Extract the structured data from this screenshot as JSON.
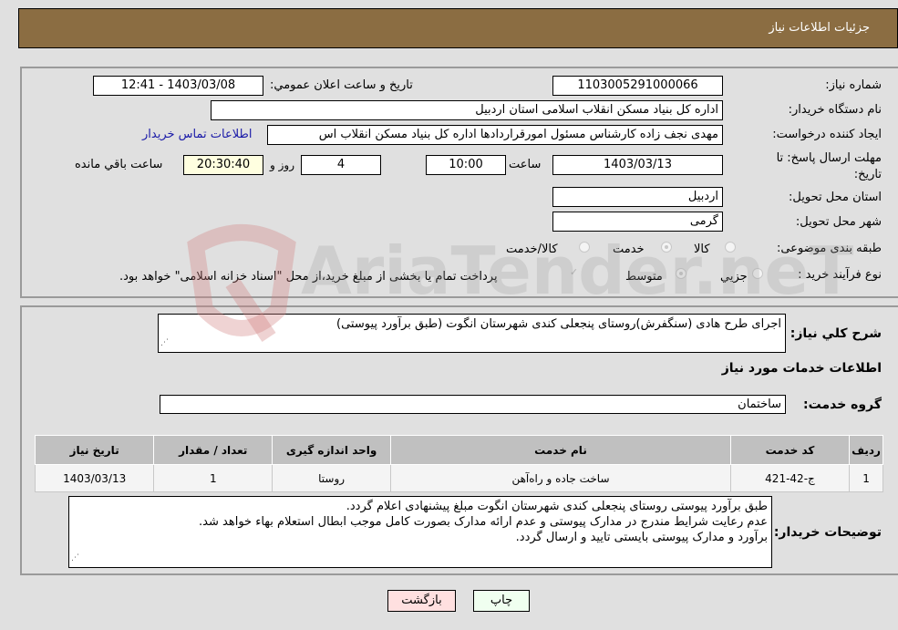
{
  "header": {
    "title": "جزئیات اطلاعات نیاز"
  },
  "fields": {
    "need_number_label": "شماره نیاز:",
    "need_number": "1103005291000066",
    "announce_label": "تاریخ و ساعت اعلان عمومي:",
    "announce_value": "1403/03/08 - 12:41",
    "buyer_org_label": "نام دستگاه خریدار:",
    "buyer_org": "اداره کل بنیاد مسکن انقلاب اسلامی استان اردبیل",
    "creator_label": "ایجاد کننده درخواست:",
    "creator": "مهدی نجف زاده کارشناس مسئول امورقراردادها اداره کل بنیاد مسکن انقلاب اس",
    "contact_link": "اطلاعات تماس خریدار",
    "deadline_label_1": "مهلت ارسال پاسخ: تا",
    "deadline_label_2": "تاریخ:",
    "deadline_date": "1403/03/13",
    "time_label": "ساعت",
    "deadline_time": "10:00",
    "days_value": "4",
    "days_label": "روز و",
    "remaining_time": "20:30:40",
    "remaining_label": "ساعت باقي مانده",
    "province_label": "استان محل تحویل:",
    "province": "اردبیل",
    "city_label": "شهر محل تحویل:",
    "city": "گرمی",
    "category_label": "طبقه بندی موضوعی:",
    "category_options": [
      "کالا",
      "خدمت",
      "کالا/خدمت"
    ],
    "category_selected": "خدمت",
    "process_label": "نوع فرآیند خرید :",
    "process_options": [
      "جزيي",
      "متوسط"
    ],
    "process_selected": "متوسط",
    "payment_note": "پرداخت تمام یا بخشی از مبلغ خرید،از محل \"اسناد خزانه اسلامی\" خواهد بود."
  },
  "description": {
    "label": "شرح كلي نياز:",
    "value": "اجرای طرح هادی (سنگفرش)روستای پنجعلی کندی شهرستان انگوت  (طبق برآورد  پیوستی)"
  },
  "services": {
    "section_title": "اطلاعات خدمات مورد نياز",
    "group_label": "گروه خدمت:",
    "group_value": "ساختمان",
    "columns": [
      "رديف",
      "كد خدمت",
      "نام خدمت",
      "واحد اندازه گيری",
      "تعداد / مقدار",
      "تاريخ نياز"
    ],
    "rows": [
      [
        "1",
        "ج-42-421",
        "ساخت جاده و راه‌آهن",
        "روستا",
        "1",
        "1403/03/13"
      ]
    ]
  },
  "buyer_notes": {
    "label": "توضيحات خريدار:",
    "lines": [
      "طبق برآورد پیوستی روستای پنجعلی کندی شهرستان انگوت مبلغ پیشنهادی اعلام گردد.",
      "عدم رعایت شرایط مندرج در مدارک پیوستی و عدم ارائه مدارک بصورت کامل موجب ابطال استعلام بهاء خواهد شد.",
      "برآورد و مدارک پیوستی بایستی تایید و ارسال گردد."
    ]
  },
  "buttons": {
    "print": "چاپ",
    "back": "بازگشت"
  },
  "watermark": "AriaTender.neT",
  "colors": {
    "header": "#8b6d42",
    "print_bg": "#f0fff0",
    "back_bg": "#ffe0e0",
    "link": "#1a1aa8"
  }
}
